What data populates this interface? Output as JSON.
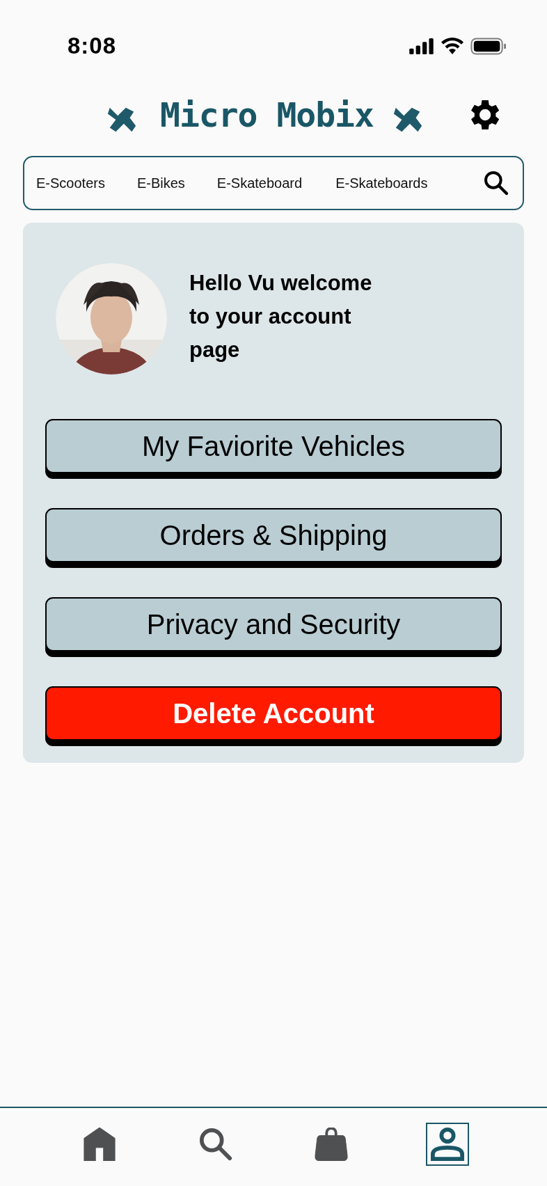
{
  "status_bar": {
    "time": "8:08"
  },
  "header": {
    "title": "Micro Mobix"
  },
  "category_bar": {
    "items": [
      "E-Scooters",
      "E-Bikes",
      "E-Skateboard",
      "E-Skateboards"
    ]
  },
  "account": {
    "greeting": "Hello Vu welcome to your account page",
    "actions": [
      {
        "label": "My Faviorite Vehicles",
        "kind": "normal"
      },
      {
        "label": "Orders & Shipping",
        "kind": "normal"
      },
      {
        "label": "Privacy and Security",
        "kind": "normal"
      },
      {
        "label": "Delete Account",
        "kind": "danger"
      }
    ]
  },
  "bottom_nav": [
    {
      "kind": "home",
      "selected": false
    },
    {
      "kind": "search",
      "selected": false
    },
    {
      "kind": "bag",
      "selected": false
    },
    {
      "kind": "profile",
      "selected": true
    }
  ]
}
